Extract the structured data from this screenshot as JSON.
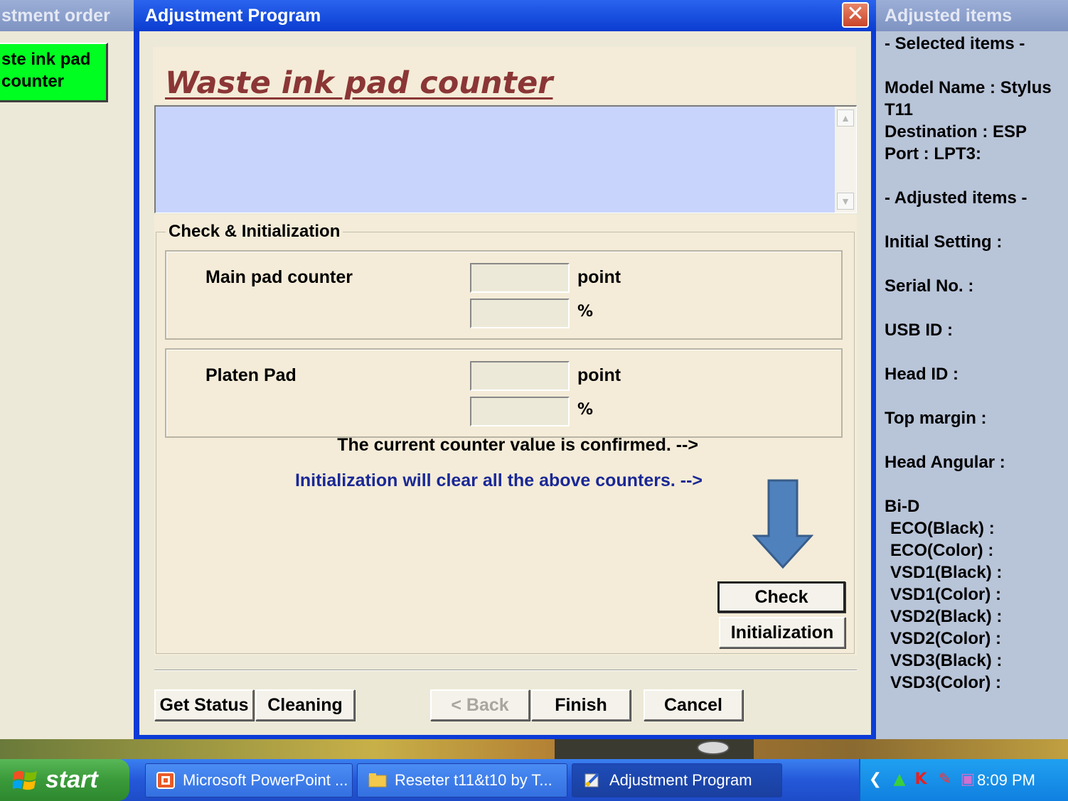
{
  "left_window": {
    "title": "stment order",
    "selected_item_line1": "ste ink pad",
    "selected_item_line2": "counter"
  },
  "dialog": {
    "title": "Adjustment Program",
    "close_glyph": "✕",
    "page_title": "Waste ink pad counter",
    "group_title": "Check & Initialization",
    "main_pad": {
      "label": "Main pad counter",
      "point_value": "",
      "percent_value": "",
      "point_unit": "point",
      "percent_unit": "%"
    },
    "platen_pad": {
      "label": "Platen Pad",
      "point_value": "",
      "percent_value": "",
      "point_unit": "point",
      "percent_unit": "%"
    },
    "check_message": "The current counter value is confirmed. -->",
    "init_message": "Initialization will clear all the above counters. -->",
    "check_button": "Check",
    "init_button": "Initialization",
    "buttons": {
      "get_status": "Get Status",
      "cleaning": "Cleaning",
      "back": "< Back",
      "finish": "Finish",
      "cancel": "Cancel"
    },
    "arrow_color": "#4f81bd"
  },
  "right_panel": {
    "title": "Adjusted items",
    "lines": [
      "- Selected items -",
      "",
      "Model Name : Stylus",
      "T11",
      "Destination : ESP",
      "Port : LPT3:",
      "",
      "- Adjusted items -",
      "",
      "Initial Setting :",
      "",
      "Serial No. :",
      "",
      "USB ID :",
      "",
      "Head ID :",
      "",
      "Top margin :",
      "",
      "Head Angular :",
      "",
      "Bi-D",
      " ECO(Black)  :",
      " ECO(Color)  :",
      " VSD1(Black) :",
      " VSD1(Color) :",
      " VSD2(Black) :",
      " VSD2(Color) :",
      " VSD3(Black) :",
      " VSD3(Color) :"
    ]
  },
  "taskbar": {
    "start_label": "start",
    "tasks": [
      {
        "label": "Microsoft PowerPoint ...",
        "icon": "powerpoint-icon"
      },
      {
        "label": "Reseter t11&t10 by T...",
        "icon": "folder-icon"
      },
      {
        "label": "Adjustment Program",
        "icon": "program-icon"
      }
    ],
    "clock": "8:09 PM"
  }
}
